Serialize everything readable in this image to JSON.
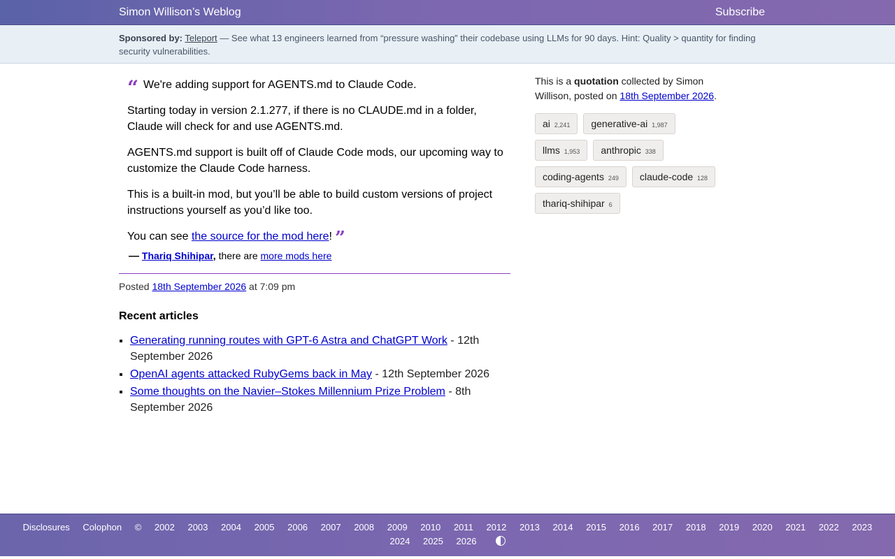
{
  "header": {
    "site_title": "Simon Willison’s Weblog",
    "subscribe": "Subscribe"
  },
  "sponsor": {
    "label": "Sponsored by:",
    "name": "Teleport",
    "text": "— See what 13 engineers learned from “pressure washing” their codebase using LLMs for 90 days. Hint: Quality > quantity for finding security vulnerabilities."
  },
  "quote": {
    "open_mark": "“",
    "close_mark": "”",
    "p1": "We're adding support for AGENTS.md to Claude Code.",
    "p2": "Starting today in version 2.1.277, if there is no CLAUDE.md in a folder, Claude will check for and use AGENTS.md.",
    "p3": "AGENTS.md support is built off of Claude Code mods, our upcoming way to customize the Claude Code harness.",
    "p4": "This is a built-in mod, but you’ll be able to build custom versions of project instructions yourself as you’d like too.",
    "p5_prefix": "You can see ",
    "p5_link": "the source for the mod here",
    "p5_suffix": "!"
  },
  "citation": {
    "dash": "—",
    "author": "Thariq Shihipar",
    "comma": ",",
    "middle": " there are ",
    "link": "more mods here"
  },
  "posted": {
    "prefix": "Posted ",
    "date": "18th September 2026",
    "suffix": " at 7:09 pm"
  },
  "recent": {
    "title": "Recent articles",
    "items": [
      {
        "title": "Generating running routes with GPT-6 Astra and ChatGPT Work",
        "date": " - 12th September 2026"
      },
      {
        "title": "OpenAI agents attacked RubyGems back in May",
        "date": " - 12th September 2026"
      },
      {
        "title": "Some thoughts on the Navier–Stokes Millennium Prize Problem",
        "date": " - 8th September 2026"
      }
    ]
  },
  "sidebar": {
    "about_prefix": "This is a ",
    "about_type": "quotation",
    "about_mid": " collected by Simon Willison, posted on ",
    "about_date": "18th September 2026",
    "about_end": ".",
    "tags": [
      {
        "name": "ai",
        "count": "2,241"
      },
      {
        "name": "generative-ai",
        "count": "1,987"
      },
      {
        "name": "llms",
        "count": "1,953"
      },
      {
        "name": "anthropic",
        "count": "338"
      },
      {
        "name": "coding-agents",
        "count": "249"
      },
      {
        "name": "claude-code",
        "count": "128"
      },
      {
        "name": "thariq-shihipar",
        "count": "6"
      }
    ]
  },
  "footer": {
    "disclosures": "Disclosures",
    "colophon": "Colophon",
    "copyright": "©",
    "years": [
      "2002",
      "2003",
      "2004",
      "2005",
      "2006",
      "2007",
      "2008",
      "2009",
      "2010",
      "2011",
      "2012",
      "2013",
      "2014",
      "2015",
      "2016",
      "2017",
      "2018",
      "2019",
      "2020",
      "2021",
      "2022",
      "2023",
      "2024",
      "2025",
      "2026"
    ],
    "theme_toggle_icon": "contrast-icon"
  }
}
